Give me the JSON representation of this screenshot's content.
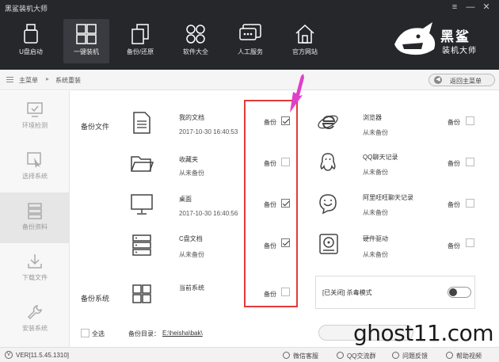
{
  "window": {
    "title": "黑鲨装机大师",
    "controls": [
      "menu",
      "minimize",
      "close"
    ]
  },
  "nav": [
    {
      "label": "U盘启动",
      "icon": "usb-icon"
    },
    {
      "label": "一键装机",
      "icon": "windows-icon",
      "active": true
    },
    {
      "label": "备份/还原",
      "icon": "backup-restore-icon"
    },
    {
      "label": "软件大全",
      "icon": "apps-grid-icon"
    },
    {
      "label": "人工服务",
      "icon": "chat-icon"
    },
    {
      "label": "官方网站",
      "icon": "home-icon"
    }
  ],
  "logo": {
    "line1": "黑鲨",
    "line2": "装机大师"
  },
  "breadcrumb": {
    "root": "主菜单",
    "current": "系统重装",
    "back_label": "返回主菜单"
  },
  "sidebar": [
    {
      "label": "环境检测",
      "icon": "monitor-check-icon"
    },
    {
      "label": "选择系统",
      "icon": "cursor-select-icon"
    },
    {
      "label": "备份资料",
      "icon": "database-icon",
      "active": true
    },
    {
      "label": "下载文件",
      "icon": "download-icon"
    },
    {
      "label": "安装系统",
      "icon": "wrench-icon"
    }
  ],
  "sections": {
    "files": "备份文件",
    "system": "备份系统"
  },
  "backup_word": "备份",
  "left_items": [
    {
      "name": "我的文档",
      "sub": "2017-10-30 16:40:53",
      "checked": true,
      "icon": "document-icon"
    },
    {
      "name": "收藏夹",
      "sub": "从未备份",
      "checked": false,
      "icon": "folder-icon"
    },
    {
      "name": "桌面",
      "sub": "2017-10-30 16:40:56",
      "checked": true,
      "icon": "desktop-icon"
    },
    {
      "name": "C盘文档",
      "sub": "从未备份",
      "checked": true,
      "icon": "server-drive-icon"
    },
    {
      "name": "当前系统",
      "sub": "",
      "checked": false,
      "icon": "windows-icon"
    }
  ],
  "right_items": [
    {
      "name": "浏览器",
      "sub": "从未备份",
      "checked": false,
      "icon": "ie-browser-icon"
    },
    {
      "name": "QQ聊天记录",
      "sub": "从未备份",
      "checked": false,
      "icon": "qq-icon"
    },
    {
      "name": "阿里旺旺聊天记录",
      "sub": "从未备份",
      "checked": false,
      "icon": "wangwang-icon"
    },
    {
      "name": "硬件驱动",
      "sub": "从未备份",
      "checked": false,
      "icon": "driver-icon"
    }
  ],
  "kill_mode": {
    "label": "[已关闭] 杀毒模式",
    "on": false
  },
  "footer": {
    "select_all": "全选",
    "dir_label": "备份目录：",
    "dir_value": "E:\\heisha\\bak\\"
  },
  "status": {
    "version": "VER[11.5.45.1310]",
    "links": [
      "微信客服",
      "QQ交流群",
      "问题反馈",
      "帮助视频"
    ]
  },
  "watermark": "ghost11.com",
  "colors": {
    "header_bg": "#26272b",
    "highlight": "#e23a3a",
    "arrow": "#e040c8"
  }
}
